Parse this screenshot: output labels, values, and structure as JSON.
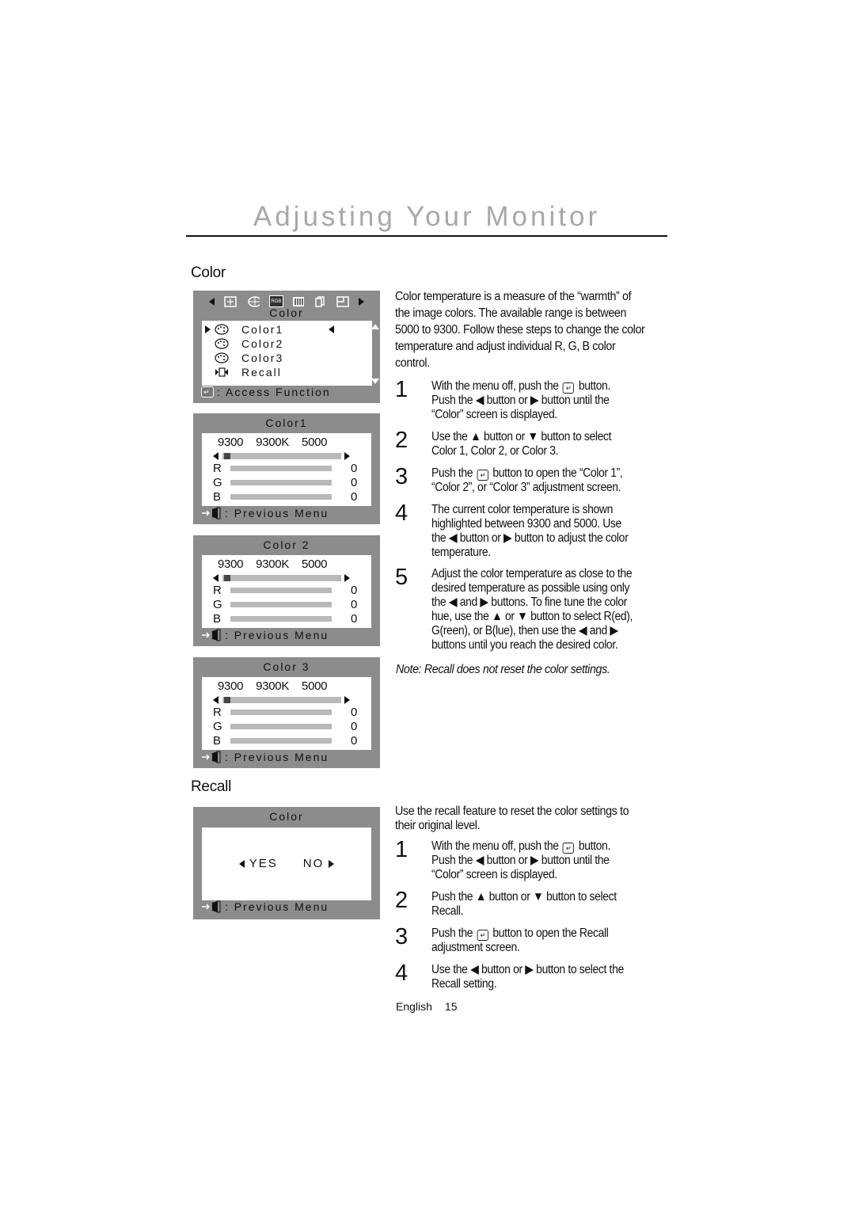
{
  "page": {
    "title": "Adjusting Your Monitor",
    "footer_language": "English",
    "footer_page": "15"
  },
  "color_section": {
    "heading": "Color",
    "intro": "Color temperature is a measure of the “warmth” of the image colors. The available range is between 5000 to 9300. Follow these steps to change the color temperature and adjust individual R, G, B color control.",
    "steps": [
      {
        "num": "1",
        "text": "With the menu off, push the [enter] button. Push the ◀ button or ▶ button until the “Color” screen is displayed.",
        "a": "With the menu off, push the",
        "b": "button.",
        "c": "Push the ◀ button or ▶ button until the",
        "d": "“Color” screen is displayed."
      },
      {
        "num": "2",
        "a": "Use the ▲ button or ▼ button to select",
        "b": "Color 1, Color 2, or Color 3."
      },
      {
        "num": "3",
        "a": "Push the",
        "b": "button to open the “Color 1”,",
        "c": "“Color 2”, or “Color 3” adjustment screen."
      },
      {
        "num": "4",
        "a": "The current color temperature is shown",
        "b": "highlighted between 9300 and 5000. Use",
        "c": "the ◀ button or ▶ button to adjust the color",
        "d": "temperature."
      },
      {
        "num": "5",
        "a": "Adjust the color temperature as close to the",
        "b": "desired temperature as possible using only",
        "c": "the ◀ and ▶ buttons. To fine tune the color",
        "d": "hue, use the ▲  or ▼ button to select R(ed),",
        "e": "G(reen), or B(lue), then use the ◀ and ▶",
        "f": "buttons until you reach the desired color."
      }
    ],
    "note": "Note: Recall does not reset the color settings."
  },
  "osd_main": {
    "title": "Color",
    "icons": [
      "left-arrow",
      "position",
      "geometry",
      "rgb",
      "sharpness",
      "language",
      "osd-position",
      "right-arrow"
    ],
    "rgb_icon_text": "RGB",
    "items": [
      {
        "label": "Color1",
        "selected": true
      },
      {
        "label": "Color2",
        "selected": false
      },
      {
        "label": "Color3",
        "selected": false
      },
      {
        "label": "Recall",
        "selected": false
      }
    ],
    "footer": ": Access Function"
  },
  "osd_color_screens": [
    {
      "title": "Color1",
      "temp_low": "9300",
      "temp_current": "9300K",
      "temp_high": "5000",
      "temp_position": 0.0,
      "rgb": [
        {
          "label": "R",
          "value": "0"
        },
        {
          "label": "G",
          "value": "0"
        },
        {
          "label": "B",
          "value": "0"
        }
      ],
      "footer": ": Previous Menu"
    },
    {
      "title": "Color 2",
      "temp_low": "9300",
      "temp_current": "9300K",
      "temp_high": "5000",
      "temp_position": 0.0,
      "rgb": [
        {
          "label": "R",
          "value": "0"
        },
        {
          "label": "G",
          "value": "0"
        },
        {
          "label": "B",
          "value": "0"
        }
      ],
      "footer": ": Previous Menu"
    },
    {
      "title": "Color 3",
      "temp_low": "9300",
      "temp_current": "9300K",
      "temp_high": "5000",
      "temp_position": 0.0,
      "rgb": [
        {
          "label": "R",
          "value": "0"
        },
        {
          "label": "G",
          "value": "0"
        },
        {
          "label": "B",
          "value": "0"
        }
      ],
      "footer": ": Previous Menu"
    }
  ],
  "recall_section": {
    "heading": "Recall",
    "intro_a": "Use the recall feature to reset the color settings to",
    "intro_b": "their original level.",
    "osd": {
      "title": "Color",
      "yes": "YES",
      "no": "NO",
      "footer": ": Previous Menu"
    },
    "steps": [
      {
        "num": "1",
        "a": "With the menu off, push the",
        "b": "button.",
        "c": "Push the ◀ button or ▶ button until the",
        "d": "“Color” screen is displayed."
      },
      {
        "num": "2",
        "a": "Push the ▲ button or ▼ button to select",
        "b": "Recall."
      },
      {
        "num": "3",
        "a": "Push the",
        "b": "button to open the Recall",
        "c": "adjustment screen."
      },
      {
        "num": "4",
        "a": "Use the ◀ button or ▶ button to select the",
        "b": "Recall setting."
      }
    ]
  },
  "colors": {
    "osd_background": "#8c8c8c",
    "osd_panel": "#ffffff",
    "slider_track": "#b9b9b9",
    "title_gray": "#a8a8a8"
  }
}
